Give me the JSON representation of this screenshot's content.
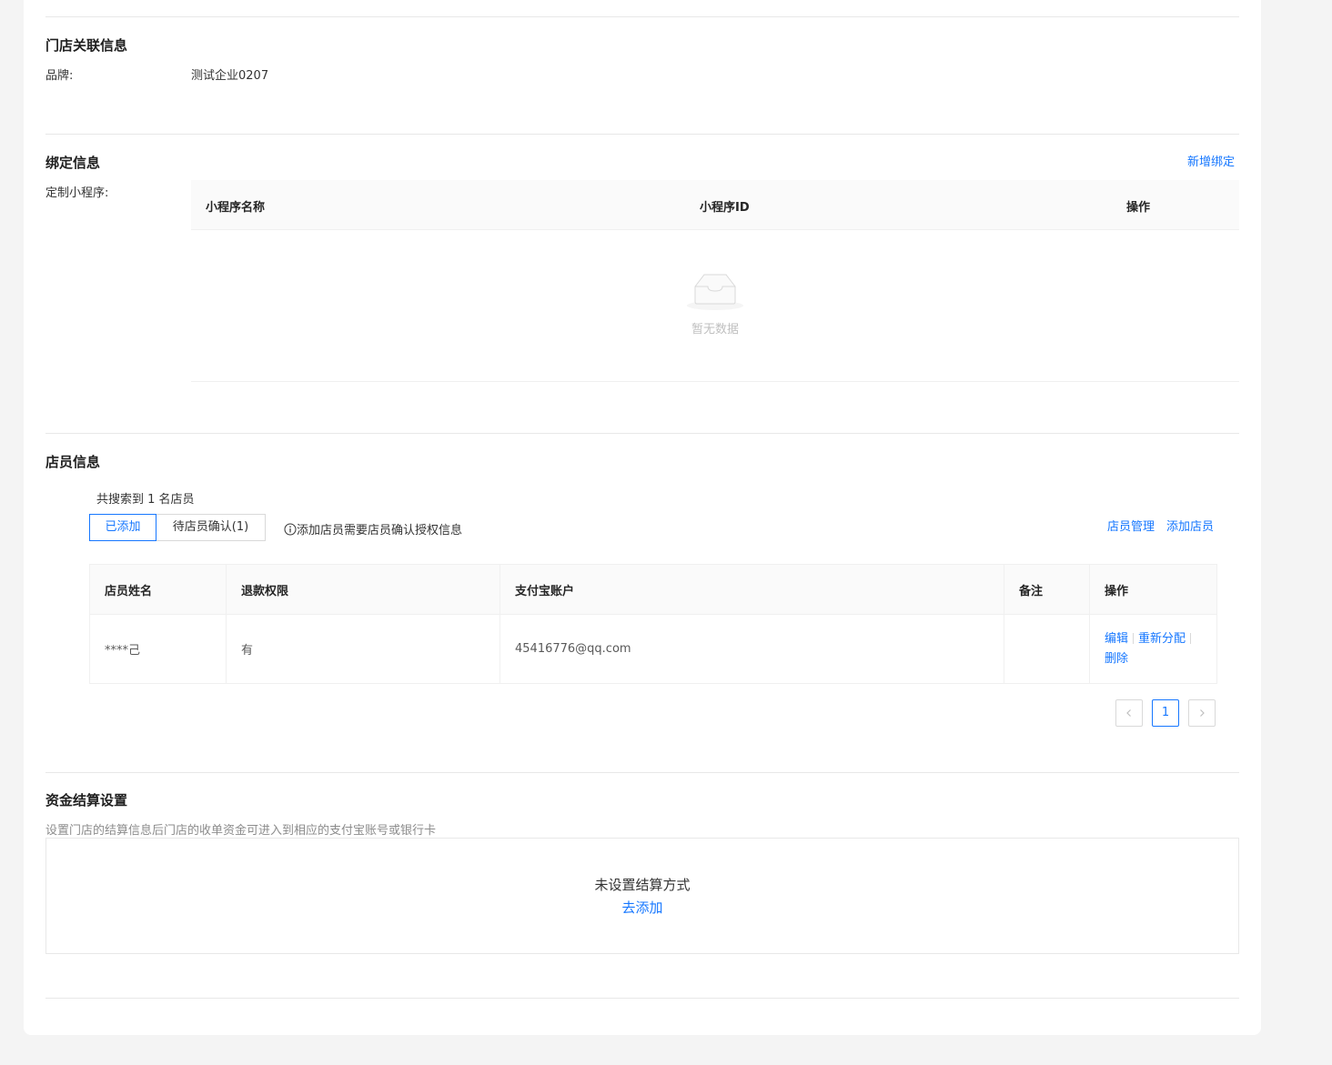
{
  "store_link": {
    "title": "门店关联信息",
    "brand_label": "品牌:",
    "brand_value": "测试企业0207"
  },
  "binding": {
    "title": "绑定信息",
    "add_link": "新增绑定",
    "miniapp_label": "定制小程序:",
    "columns": [
      "小程序名称",
      "小程序ID",
      "操作"
    ],
    "empty_text": "暂无数据"
  },
  "staff": {
    "title": "店员信息",
    "count_text": "共搜索到 1 名店员",
    "tabs": [
      "已添加",
      "待店员确认(1)"
    ],
    "hint": "添加店员需要店员确认授权信息",
    "manage_link": "店员管理",
    "add_link": "添加店员",
    "columns": [
      "店员姓名",
      "退款权限",
      "支付宝账户",
      "备注",
      "操作"
    ],
    "rows": [
      {
        "name": "****己",
        "refund": "有",
        "alipay": "45416776@qq.com",
        "remark": "",
        "actions": [
          "编辑",
          "重新分配",
          "删除"
        ]
      }
    ],
    "pagination": {
      "current": "1"
    }
  },
  "settlement": {
    "title": "资金结算设置",
    "desc": "设置门店的结算信息后门店的收单资金可进入到相应的支付宝账号或银行卡",
    "empty_text": "未设置结算方式",
    "add_link": "去添加"
  },
  "colors": {
    "accent": "#1677ff",
    "border": "#e8e8e8",
    "header_bg": "#fafafa"
  }
}
